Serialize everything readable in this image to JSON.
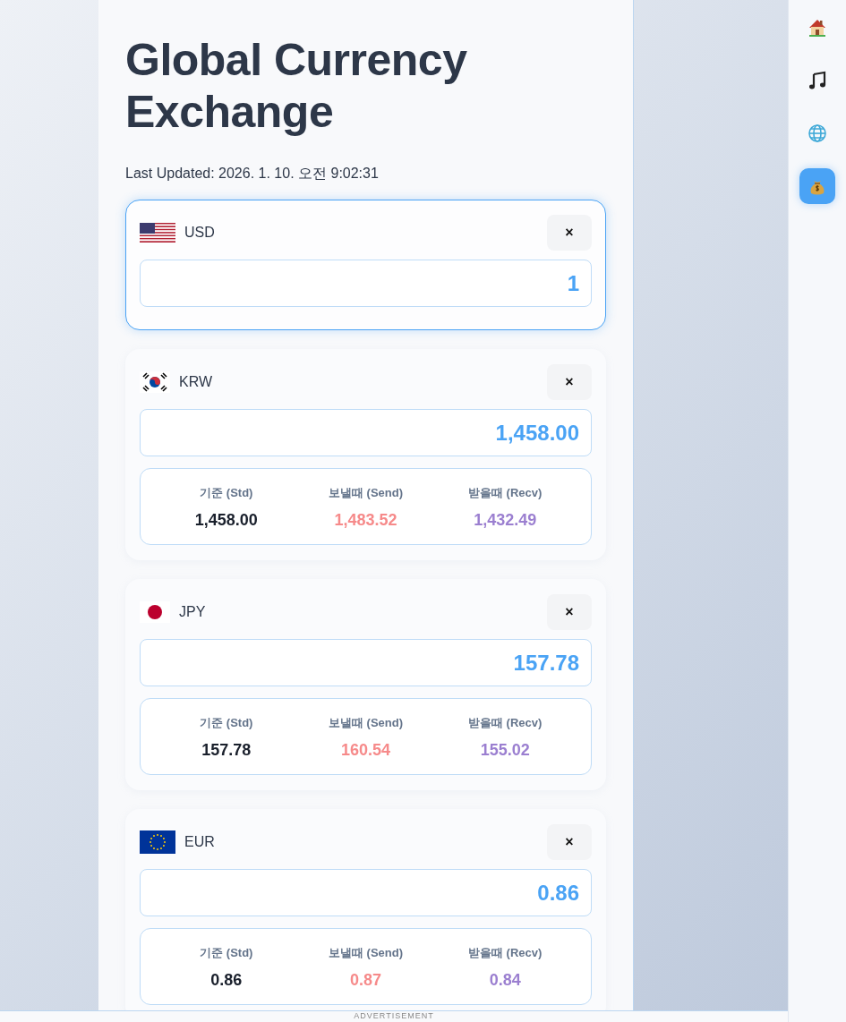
{
  "title": "Global Currency Exchange",
  "last_updated": "Last Updated: 2026. 1. 10. 오전 9:02:31",
  "currencies": [
    {
      "code": "USD",
      "selected": true,
      "close": "×",
      "value": "1"
    },
    {
      "code": "KRW",
      "selected": false,
      "close": "×",
      "value": "1,458.00",
      "rates": [
        {
          "kind": "std",
          "label": "기준 (Std)",
          "value": "1,458.00"
        },
        {
          "kind": "send",
          "label": "보낼때 (Send)",
          "value": "1,483.52"
        },
        {
          "kind": "recv",
          "label": "받을때 (Recv)",
          "value": "1,432.49"
        }
      ]
    },
    {
      "code": "JPY",
      "selected": false,
      "close": "×",
      "value": "157.78",
      "rates": [
        {
          "kind": "std",
          "label": "기준 (Std)",
          "value": "157.78"
        },
        {
          "kind": "send",
          "label": "보낼때 (Send)",
          "value": "160.54"
        },
        {
          "kind": "recv",
          "label": "받을때 (Recv)",
          "value": "155.02"
        }
      ]
    },
    {
      "code": "EUR",
      "selected": false,
      "close": "×",
      "value": "0.86",
      "rates": [
        {
          "kind": "std",
          "label": "기준 (Std)",
          "value": "0.86"
        },
        {
          "kind": "send",
          "label": "보낼때 (Send)",
          "value": "0.87"
        },
        {
          "kind": "recv",
          "label": "받을때 (Recv)",
          "value": "0.84"
        }
      ]
    }
  ],
  "sidebar": {
    "items": [
      {
        "selected": false
      },
      {
        "selected": false
      },
      {
        "selected": false
      },
      {
        "selected": true
      }
    ]
  },
  "ad_label": "ADVERTISEMENT"
}
